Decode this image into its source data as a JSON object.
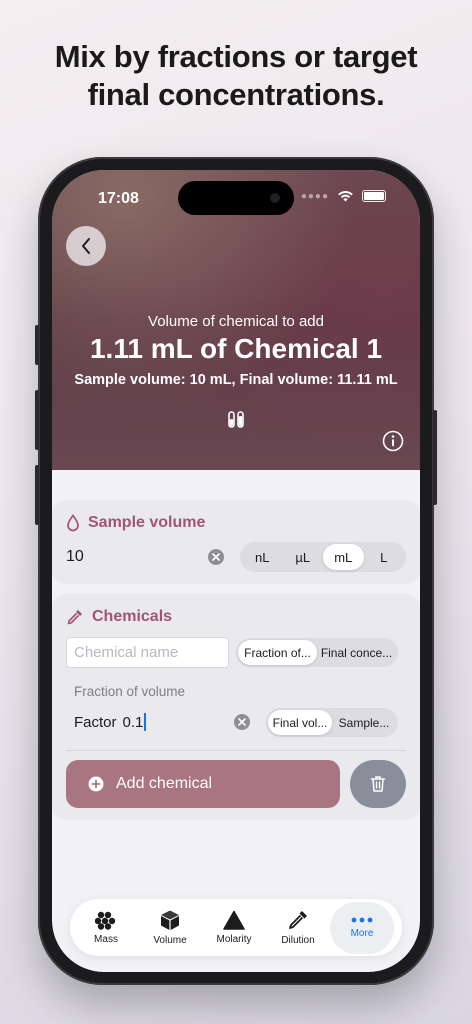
{
  "headline": {
    "line1": "Mix by fractions or target",
    "line2": "final concentrations."
  },
  "status_bar": {
    "time": "17:08"
  },
  "hero": {
    "label": "Volume of chemical to add",
    "value": "1.11 mL of Chemical 1",
    "subtitle": "Sample volume: 10 mL, Final volume:  11.11 mL"
  },
  "sample_volume": {
    "title": "Sample volume",
    "value": "10",
    "units": [
      "nL",
      "µL",
      "mL",
      "L"
    ],
    "selected_unit": "mL"
  },
  "chemicals": {
    "title": "Chemicals",
    "name_placeholder": "Chemical name",
    "mode_options": [
      "Fraction of...",
      "Final conce..."
    ],
    "selected_mode": "Fraction of...",
    "fraction_label": "Fraction of volume",
    "factor_label": "Factor",
    "factor_value": "0.1",
    "basis_options": [
      "Final vol...",
      "Sample..."
    ],
    "selected_basis": "Final vol...",
    "add_button": "Add chemical"
  },
  "tabs": [
    {
      "label": "Mass",
      "icon": "atoms-icon"
    },
    {
      "label": "Volume",
      "icon": "cube-icon"
    },
    {
      "label": "Molarity",
      "icon": "triangle-icon"
    },
    {
      "label": "Dilution",
      "icon": "dropper-icon"
    },
    {
      "label": "More",
      "icon": "ellipsis-icon"
    }
  ],
  "active_tab": "More",
  "colors": {
    "accent": "#a1566f",
    "add_button": "#a87580",
    "active_tab": "#1a73e8"
  }
}
